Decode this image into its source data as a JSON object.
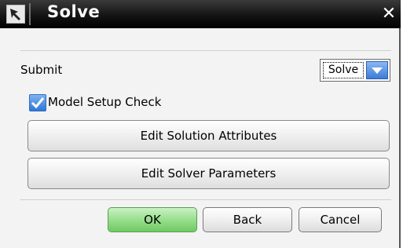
{
  "window": {
    "title": "Solve",
    "close_glyph": "✕",
    "icon": "pointer-arrow-icon"
  },
  "submit": {
    "label": "Submit",
    "selected": "Solve"
  },
  "model_setup_check": {
    "label": "Model Setup Check",
    "checked": true
  },
  "buttons": {
    "edit_solution_attributes": "Edit Solution Attributes",
    "edit_solver_parameters": "Edit Solver Parameters",
    "ok": "OK",
    "back": "Back",
    "cancel": "Cancel"
  },
  "colors": {
    "titlebar": "#000000",
    "accent_blue": "#3c7bd8",
    "ok_green": "#8fdb84"
  }
}
